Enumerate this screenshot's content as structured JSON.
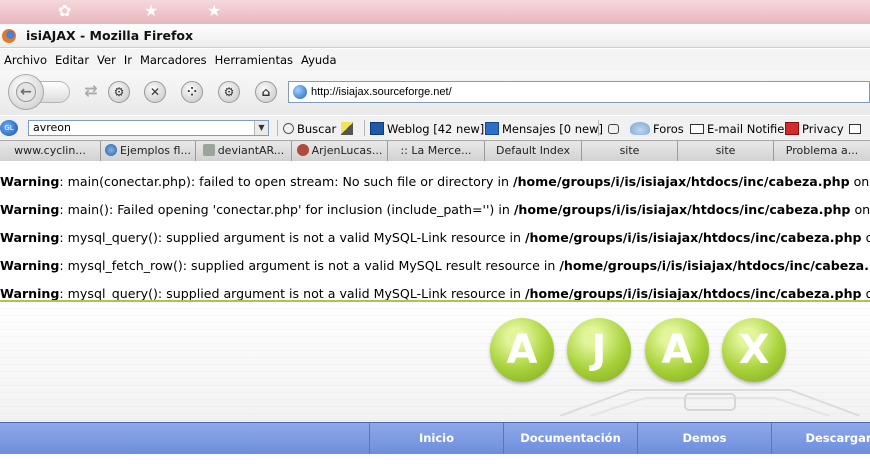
{
  "window": {
    "title": "isiAJAX - Mozilla Firefox"
  },
  "menu": [
    "Archivo",
    "Editar",
    "Ver",
    "Ir",
    "Marcadores",
    "Herramientas",
    "Ayuda"
  ],
  "menu_underline": [
    "A",
    "E",
    "V",
    "I",
    "M",
    "H",
    "y"
  ],
  "navbar": {
    "url": "http://isiajax.sourceforge.net/"
  },
  "toolbar2": {
    "search_value": "avreon",
    "search_button": "Buscar",
    "weblog": "Weblog [42 new]",
    "mensajes": "Mensajes [0 new]",
    "foros": "Foros",
    "email_notifier": "E-mail Notifier",
    "privacy": "Privacy"
  },
  "tabs": [
    "www.cyclin...",
    "Ejemplos fl...",
    "deviantAR...",
    "ArjenLucas...",
    ":: La Merce...",
    "Default Index",
    "site",
    "site",
    "Problema a..."
  ],
  "warnings": [
    {
      "label": "Warning",
      "message": ": main(conectar.php): failed to open stream: No such file or directory in ",
      "path": "/home/groups/i/is/isiajax/htdocs/inc/cabeza.php",
      "tail": " on"
    },
    {
      "label": "Warning",
      "message": ": main(): Failed opening 'conectar.php' for inclusion (include_path='') in ",
      "path": "/home/groups/i/is/isiajax/htdocs/inc/cabeza.php",
      "tail": " on l"
    },
    {
      "label": "Warning",
      "message": ": mysql_query(): supplied argument is not a valid MySQL-Link resource in ",
      "path": "/home/groups/i/is/isiajax/htdocs/inc/cabeza.php",
      "tail": " o"
    },
    {
      "label": "Warning",
      "message": ": mysql_fetch_row(): supplied argument is not a valid MySQL result resource in ",
      "path": "/home/groups/i/is/isiajax/htdocs/inc/cabeza.",
      "tail": ""
    },
    {
      "label": "Warning",
      "message": ": mysql_query(): supplied argument is not a valid MySQL-Link resource in ",
      "path": "/home/groups/i/is/isiajax/htdocs/inc/cabeza.php",
      "tail": " o"
    }
  ],
  "banner": {
    "letters": [
      "A",
      "J",
      "A",
      "X"
    ]
  },
  "site_nav": [
    "Inicio",
    "Documentación",
    "Demos",
    "Descargar"
  ],
  "colors": {
    "accent_green": "#a8d23a",
    "nav_blue": "#7b98e2",
    "warning_divider": "#a9c74a"
  }
}
